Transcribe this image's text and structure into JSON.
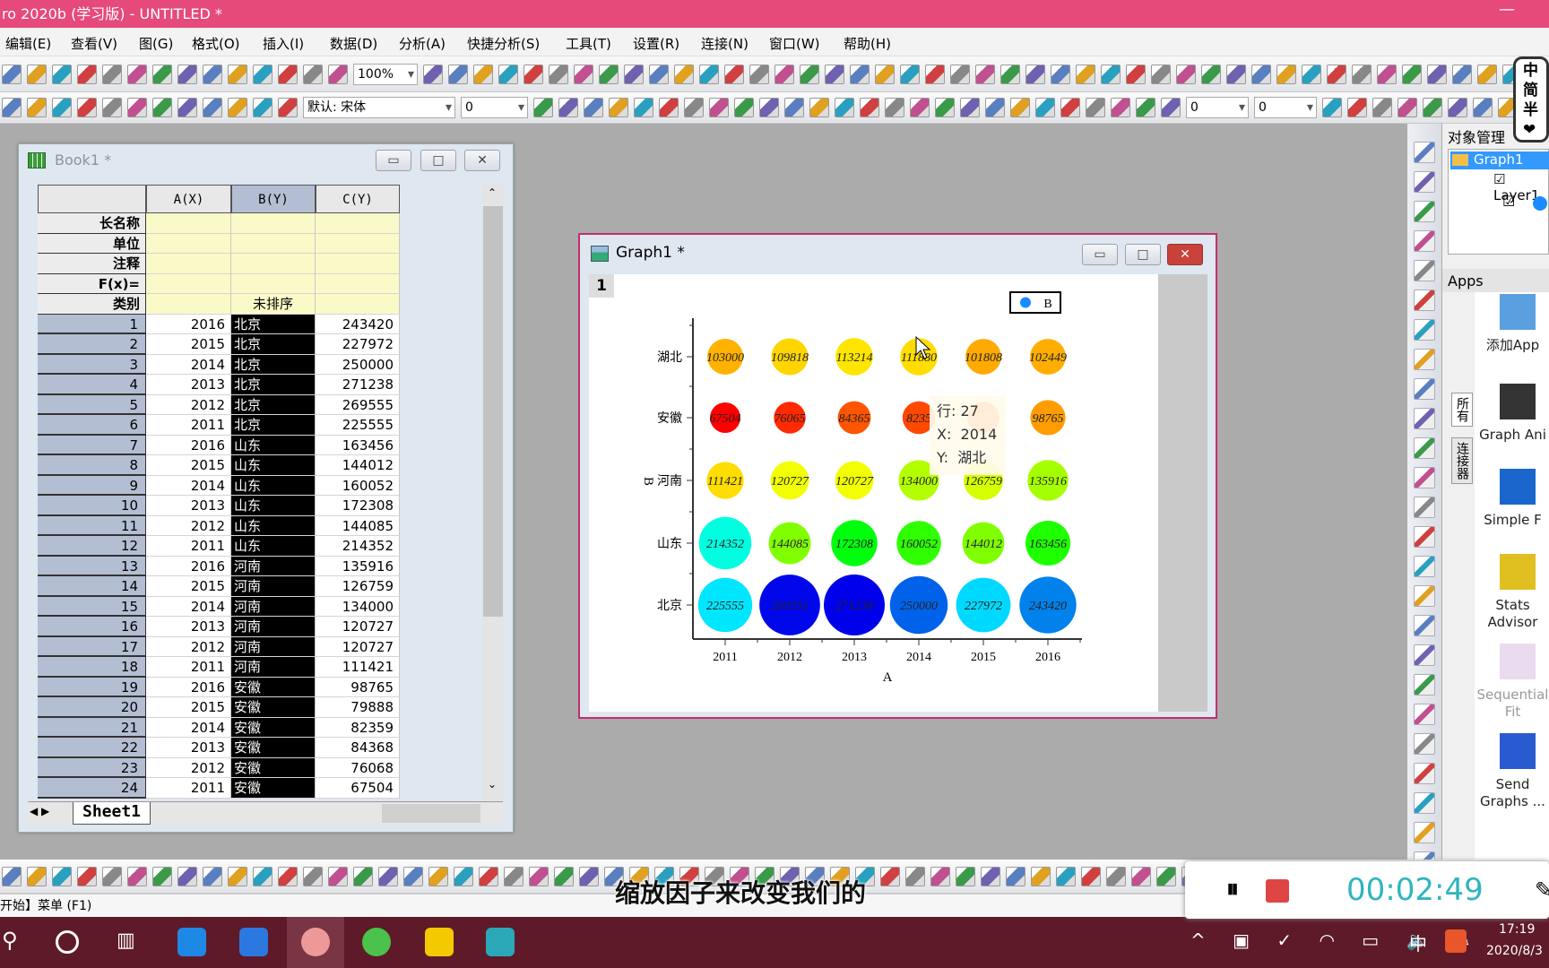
{
  "app": {
    "title": "ro 2020b (学习版) - UNTITLED *",
    "window_controls": [
      "minimize",
      "maximize",
      "close"
    ]
  },
  "menu": [
    "编辑(E)",
    "查看(V)",
    "图(G)",
    "格式(O)",
    "插入(I)",
    "数据(D)",
    "分析(A)",
    "快捷分析(S)",
    "工具(T)",
    "设置(R)",
    "连接(N)",
    "窗口(W)",
    "帮助(H)"
  ],
  "toolbar1": {
    "zoom": "100%"
  },
  "toolbar2": {
    "font": "默认: 宋体",
    "font_size": "0",
    "value1": "0",
    "value2": "0"
  },
  "colors": {
    "titlebar": "#e64a7b",
    "selection": "#000000",
    "accent": "#3399ff",
    "graph_border": "#c0306e"
  },
  "book": {
    "title": "Book1 *",
    "columns": [
      "A(X)",
      "B(Y)",
      "C(Y)"
    ],
    "meta_labels": [
      "长名称",
      "单位",
      "注释",
      "F(x)=",
      "类别"
    ],
    "category_label": "未排序",
    "rows": [
      [
        "1",
        "2016",
        "北京",
        "243420"
      ],
      [
        "2",
        "2015",
        "北京",
        "227972"
      ],
      [
        "3",
        "2014",
        "北京",
        "250000"
      ],
      [
        "4",
        "2013",
        "北京",
        "271238"
      ],
      [
        "5",
        "2012",
        "北京",
        "269555"
      ],
      [
        "6",
        "2011",
        "北京",
        "225555"
      ],
      [
        "7",
        "2016",
        "山东",
        "163456"
      ],
      [
        "8",
        "2015",
        "山东",
        "144012"
      ],
      [
        "9",
        "2014",
        "山东",
        "160052"
      ],
      [
        "10",
        "2013",
        "山东",
        "172308"
      ],
      [
        "11",
        "2012",
        "山东",
        "144085"
      ],
      [
        "12",
        "2011",
        "山东",
        "214352"
      ],
      [
        "13",
        "2016",
        "河南",
        "135916"
      ],
      [
        "14",
        "2015",
        "河南",
        "126759"
      ],
      [
        "15",
        "2014",
        "河南",
        "134000"
      ],
      [
        "16",
        "2013",
        "河南",
        "120727"
      ],
      [
        "17",
        "2012",
        "河南",
        "120727"
      ],
      [
        "18",
        "2011",
        "河南",
        "111421"
      ],
      [
        "19",
        "2016",
        "安徽",
        "98765"
      ],
      [
        "20",
        "2015",
        "安徽",
        "79888"
      ],
      [
        "21",
        "2014",
        "安徽",
        "82359"
      ],
      [
        "22",
        "2013",
        "安徽",
        "84368"
      ],
      [
        "23",
        "2012",
        "安徽",
        "76068"
      ],
      [
        "24",
        "2011",
        "安徽",
        "67504"
      ]
    ],
    "sheet_tab": "Sheet1"
  },
  "graph": {
    "title": "Graph1 *",
    "layer": "1",
    "tooltip": {
      "row_label": "行:",
      "row": "27",
      "x_label": "X:",
      "x": "2014",
      "y_label": "Y:",
      "y": "湖北"
    }
  },
  "chart_data": {
    "type": "scatter",
    "subtype": "bubble, color-mapped",
    "xlabel": "A",
    "ylabel": "B",
    "x_categories": [
      "2011",
      "2012",
      "2013",
      "2014",
      "2015",
      "2016"
    ],
    "y_categories": [
      "北京",
      "山东",
      "河南",
      "安徽",
      "湖北"
    ],
    "legend": {
      "entries": [
        "B"
      ],
      "placement": "top-right"
    },
    "grid": false,
    "colormap": "red (low) → yellow → green → cyan → blue (high)",
    "series": [
      {
        "y": "湖北",
        "values": [
          103000,
          109818,
          113214,
          111880,
          101808,
          102449
        ]
      },
      {
        "y": "安徽",
        "values": [
          67504,
          76068,
          84368,
          82359,
          79888,
          98765
        ]
      },
      {
        "y": "河南",
        "values": [
          111421,
          120727,
          120727,
          134000,
          126759,
          135916
        ]
      },
      {
        "y": "山东",
        "values": [
          214352,
          144085,
          172308,
          160052,
          144012,
          163456
        ]
      },
      {
        "y": "北京",
        "values": [
          225555,
          269555,
          271238,
          250000,
          227972,
          243420
        ]
      }
    ],
    "labels": [
      [
        "103000",
        "109818",
        "113214",
        "111880",
        "101808",
        "102449"
      ],
      [
        "67504",
        "76065",
        "84365",
        "8235",
        "",
        "98765"
      ],
      [
        "111421",
        "120727",
        "120727",
        "134000",
        "126759",
        "135916"
      ],
      [
        "214352",
        "144085",
        "172308",
        "160052",
        "144012",
        "163456"
      ],
      [
        "225555",
        "269555",
        "271238",
        "250000",
        "227972",
        "243420"
      ]
    ]
  },
  "object_manager": {
    "title": "对象管理",
    "graph": "Graph1",
    "layer": "Layer1"
  },
  "apps": {
    "title": "Apps",
    "side_tabs": [
      "所有",
      "连接器"
    ],
    "items": [
      "添加App",
      "Graph Ani",
      "Simple F",
      "Stats Advisor",
      "Sequential Fit",
      "Send Graphs ..."
    ]
  },
  "ime": [
    "中",
    "简",
    "半",
    "❤"
  ],
  "status": {
    "text": "开始】菜单 (F1)"
  },
  "subtitle": "缩放因子来改变我们的",
  "recorder": {
    "time": "00:02:49"
  },
  "taskbar": {
    "time": "17:19",
    "date": "2020/8/3",
    "ime": "中"
  }
}
